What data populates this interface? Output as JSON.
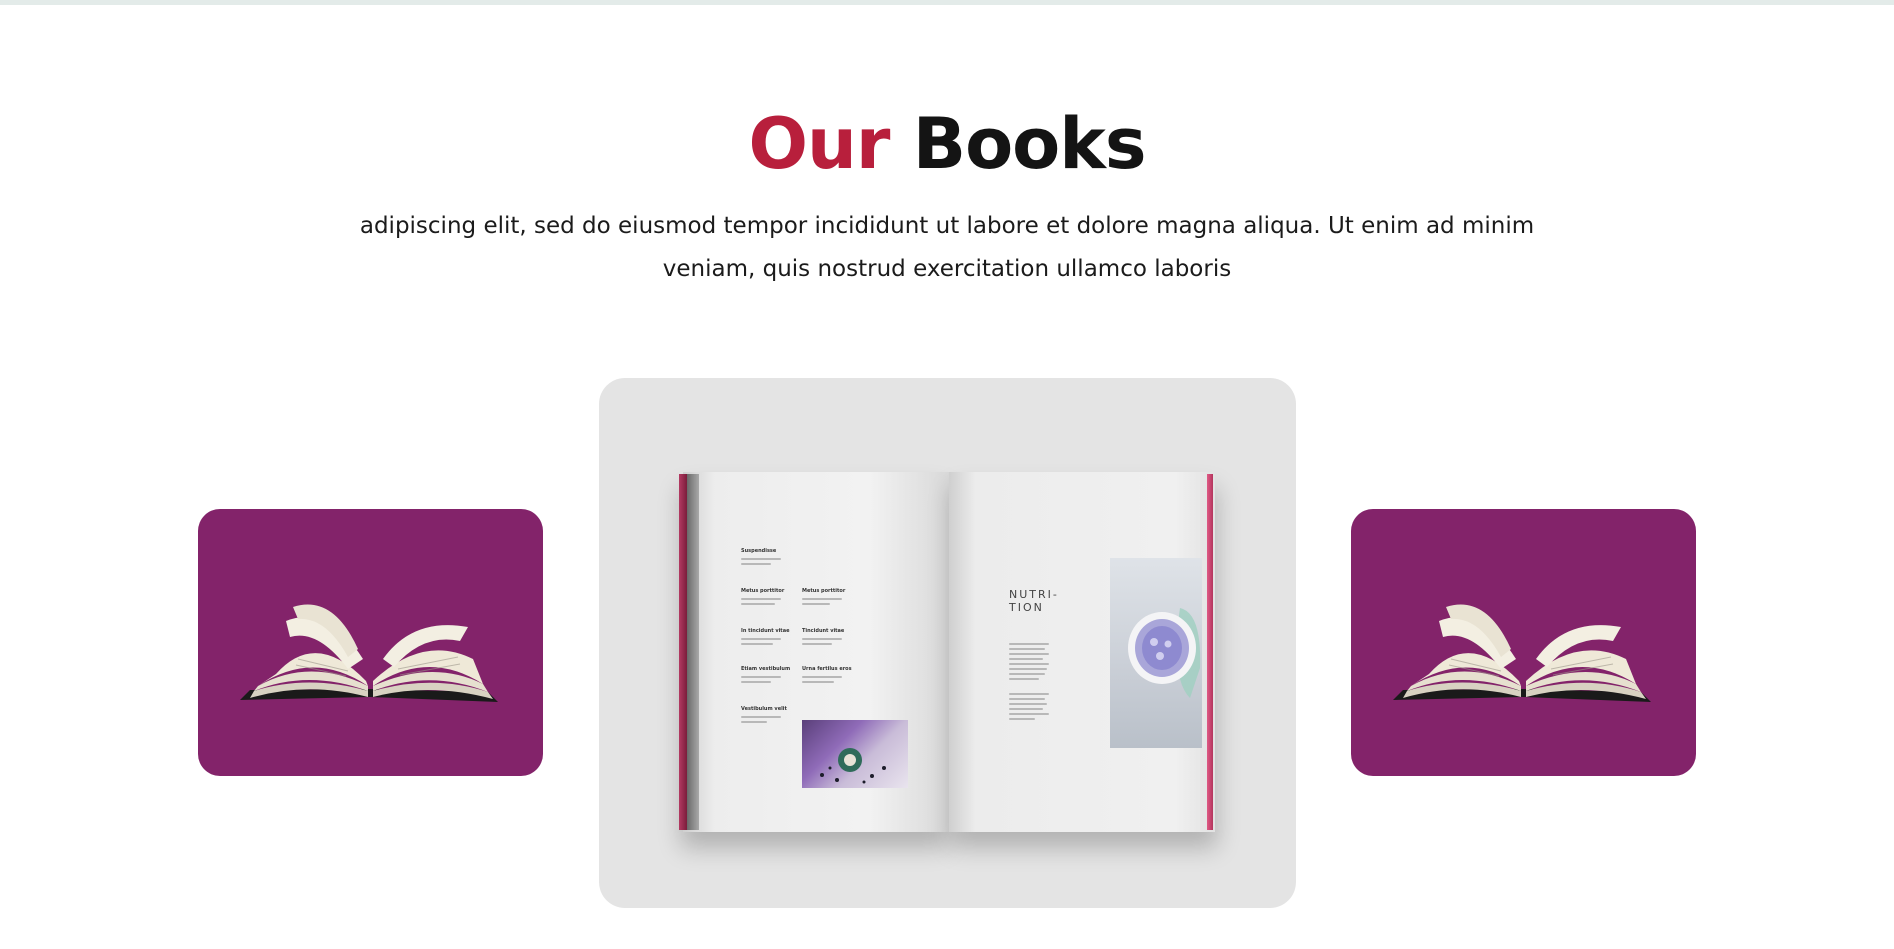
{
  "section": {
    "title_accent": "Our",
    "title_main": "Books",
    "subtitle_line1": "adipiscing elit, sed do eiusmod tempor incididunt ut labore et dolore magna aliqua. Ut enim ad minim",
    "subtitle_line2": "veniam, quis nostrud exercitation ullamco laboris"
  },
  "colors": {
    "accent": "#b81f3c",
    "heading": "#141414",
    "side_card_bg": "#83236a",
    "center_card_bg": "#e4e4e4"
  },
  "carousel": {
    "slides": [
      {
        "icon": "open-book-icon"
      },
      {
        "icon": "magazine-spread-image"
      },
      {
        "icon": "open-book-icon"
      }
    ],
    "magazine": {
      "left_headings": [
        "Suspendisse",
        "Metus porttitor",
        "Metus porttitor",
        "In tincidunt vitae",
        "Tincidunt vitae",
        "Etiam vestibulum",
        "Urna fertilus eros",
        "Vestibulum velit"
      ],
      "right_title": "NUTRI-\nTION"
    }
  }
}
